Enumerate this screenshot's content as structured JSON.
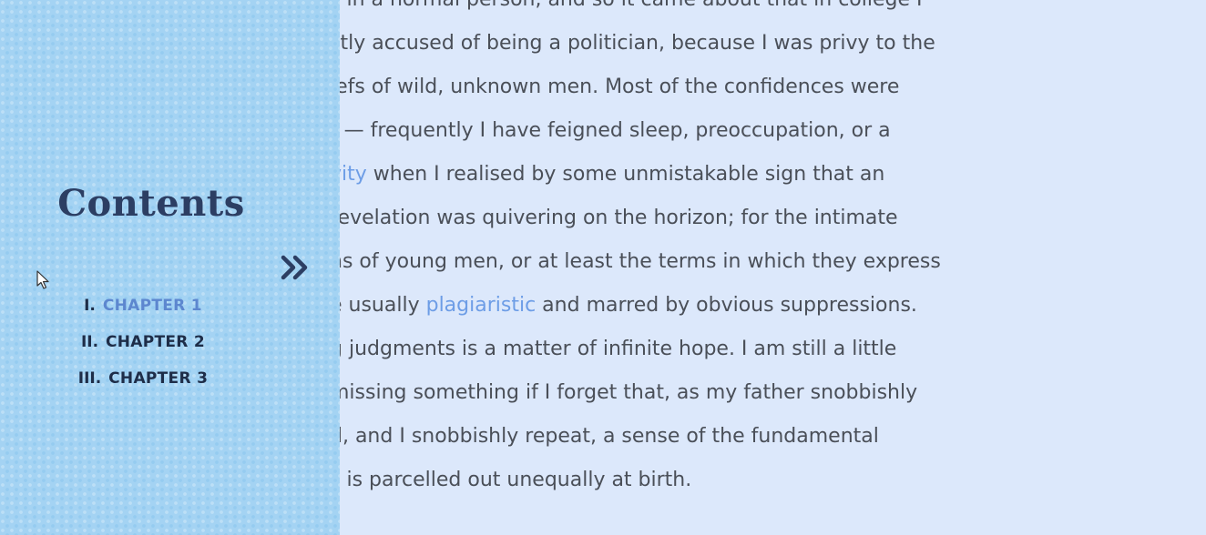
{
  "body_text": {
    "line_1": "s in a normal person, and so it came about that in college I",
    "line_2": "stly accused of being a politician, because I was privy to the",
    "line_3": "iefs of wild, unknown men. Most of the confidences were",
    "line_4": "t — frequently I have feigned sleep, preoccupation, or a",
    "line_5_link": "vity",
    "line_5_rest": " when I realised by some unmistakable sign that an",
    "line_6": "revelation was quivering on the horizon; for the intimate",
    "line_7": "ns of young men, or at least the terms in which they express",
    "line_8_pre": "e usually ",
    "line_8_link": "plagiaristic",
    "line_8_post": " and marred by obvious suppressions.",
    "line_9": "g judgments is a matter of infinite hope. I am still a little",
    "line_10": "missing something if I forget that, as my father snobbishly",
    "line_11": "d, and I snobbishly repeat, a sense of the fundamental",
    "line_12": "s is parcelled out unequally at birth."
  },
  "sidebar": {
    "title": "Contents",
    "toggle_icon": "double-chevron-right-icon",
    "items": [
      {
        "num": "I.",
        "label": "CHAPTER 1",
        "active": true
      },
      {
        "num": "II.",
        "label": "CHAPTER 2",
        "active": false
      },
      {
        "num": "III.",
        "label": "CHAPTER 3",
        "active": false
      }
    ]
  },
  "colors": {
    "page_bg": "#dce8fb",
    "sidebar_bg": "#a4d3f3",
    "text": "#4a4f58",
    "link": "#6d9de6",
    "title": "#2c3e63",
    "toc_active": "#5d87cf"
  }
}
